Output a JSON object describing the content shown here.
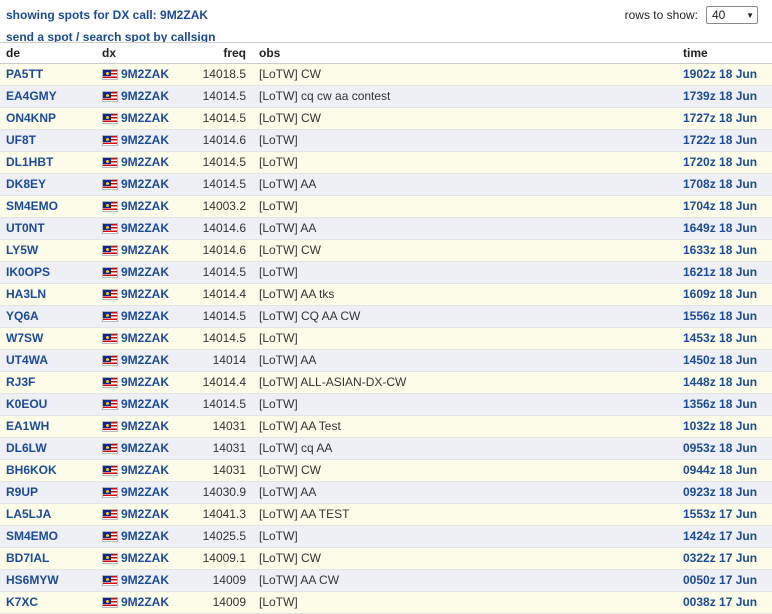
{
  "header": {
    "title": "showing spots for DX call: 9M2ZAK",
    "send_spot": "send a spot",
    "separator": " / ",
    "search_spot": "search spot by callsign",
    "rows_label": "rows to show:",
    "rows_value": "40"
  },
  "columns": {
    "de": "de",
    "dx": "dx",
    "freq": "freq",
    "obs": "obs",
    "time": "time"
  },
  "rows": [
    {
      "de": "PA5TT",
      "dx": "9M2ZAK",
      "freq": "14018.5",
      "obs": "[LoTW] CW",
      "time": "1902z 18 Jun"
    },
    {
      "de": "EA4GMY",
      "dx": "9M2ZAK",
      "freq": "14014.5",
      "obs": "[LoTW] cq cw aa contest",
      "time": "1739z 18 Jun"
    },
    {
      "de": "ON4KNP",
      "dx": "9M2ZAK",
      "freq": "14014.5",
      "obs": "[LoTW] CW",
      "time": "1727z 18 Jun"
    },
    {
      "de": "UF8T",
      "dx": "9M2ZAK",
      "freq": "14014.6",
      "obs": "[LoTW]",
      "time": "1722z 18 Jun"
    },
    {
      "de": "DL1HBT",
      "dx": "9M2ZAK",
      "freq": "14014.5",
      "obs": "[LoTW]",
      "time": "1720z 18 Jun"
    },
    {
      "de": "DK8EY",
      "dx": "9M2ZAK",
      "freq": "14014.5",
      "obs": "[LoTW] AA",
      "time": "1708z 18 Jun"
    },
    {
      "de": "SM4EMO",
      "dx": "9M2ZAK",
      "freq": "14003.2",
      "obs": "[LoTW]",
      "time": "1704z 18 Jun"
    },
    {
      "de": "UT0NT",
      "dx": "9M2ZAK",
      "freq": "14014.6",
      "obs": "[LoTW] AA",
      "time": "1649z 18 Jun"
    },
    {
      "de": "LY5W",
      "dx": "9M2ZAK",
      "freq": "14014.6",
      "obs": "[LoTW] CW",
      "time": "1633z 18 Jun"
    },
    {
      "de": "IK0OPS",
      "dx": "9M2ZAK",
      "freq": "14014.5",
      "obs": "[LoTW]",
      "time": "1621z 18 Jun"
    },
    {
      "de": "HA3LN",
      "dx": "9M2ZAK",
      "freq": "14014.4",
      "obs": "[LoTW] AA tks",
      "time": "1609z 18 Jun"
    },
    {
      "de": "YQ6A",
      "dx": "9M2ZAK",
      "freq": "14014.5",
      "obs": "[LoTW] CQ AA CW",
      "time": "1556z 18 Jun"
    },
    {
      "de": "W7SW",
      "dx": "9M2ZAK",
      "freq": "14014.5",
      "obs": "[LoTW]",
      "time": "1453z 18 Jun"
    },
    {
      "de": "UT4WA",
      "dx": "9M2ZAK",
      "freq": "14014",
      "obs": "[LoTW] AA",
      "time": "1450z 18 Jun"
    },
    {
      "de": "RJ3F",
      "dx": "9M2ZAK",
      "freq": "14014.4",
      "obs": "[LoTW] ALL-ASIAN-DX-CW",
      "time": "1448z 18 Jun"
    },
    {
      "de": "K0EOU",
      "dx": "9M2ZAK",
      "freq": "14014.5",
      "obs": "[LoTW]",
      "time": "1356z 18 Jun"
    },
    {
      "de": "EA1WH",
      "dx": "9M2ZAK",
      "freq": "14031",
      "obs": "[LoTW] AA Test",
      "time": "1032z 18 Jun"
    },
    {
      "de": "DL6LW",
      "dx": "9M2ZAK",
      "freq": "14031",
      "obs": "[LoTW] cq AA",
      "time": "0953z 18 Jun"
    },
    {
      "de": "BH6KOK",
      "dx": "9M2ZAK",
      "freq": "14031",
      "obs": "[LoTW] CW",
      "time": "0944z 18 Jun"
    },
    {
      "de": "R9UP",
      "dx": "9M2ZAK",
      "freq": "14030.9",
      "obs": "[LoTW] AA",
      "time": "0923z 18 Jun"
    },
    {
      "de": "LA5LJA",
      "dx": "9M2ZAK",
      "freq": "14041.3",
      "obs": "[LoTW] AA TEST",
      "time": "1553z 17 Jun"
    },
    {
      "de": "SM4EMO",
      "dx": "9M2ZAK",
      "freq": "14025.5",
      "obs": "[LoTW]",
      "time": "1424z 17 Jun"
    },
    {
      "de": "BD7IAL",
      "dx": "9M2ZAK",
      "freq": "14009.1",
      "obs": "[LoTW] CW",
      "time": "0322z 17 Jun"
    },
    {
      "de": "HS6MYW",
      "dx": "9M2ZAK",
      "freq": "14009",
      "obs": "[LoTW] AA CW",
      "time": "0050z 17 Jun"
    },
    {
      "de": "K7XC",
      "dx": "9M2ZAK",
      "freq": "14009",
      "obs": "[LoTW]",
      "time": "0038z 17 Jun"
    }
  ],
  "colors": {
    "link": "#1a4a9a",
    "row_odd": "#fefde9",
    "row_even": "#eef0f6"
  },
  "icons": {
    "flag": "malaysia-flag-icon",
    "caret": "chevron-down-icon"
  }
}
